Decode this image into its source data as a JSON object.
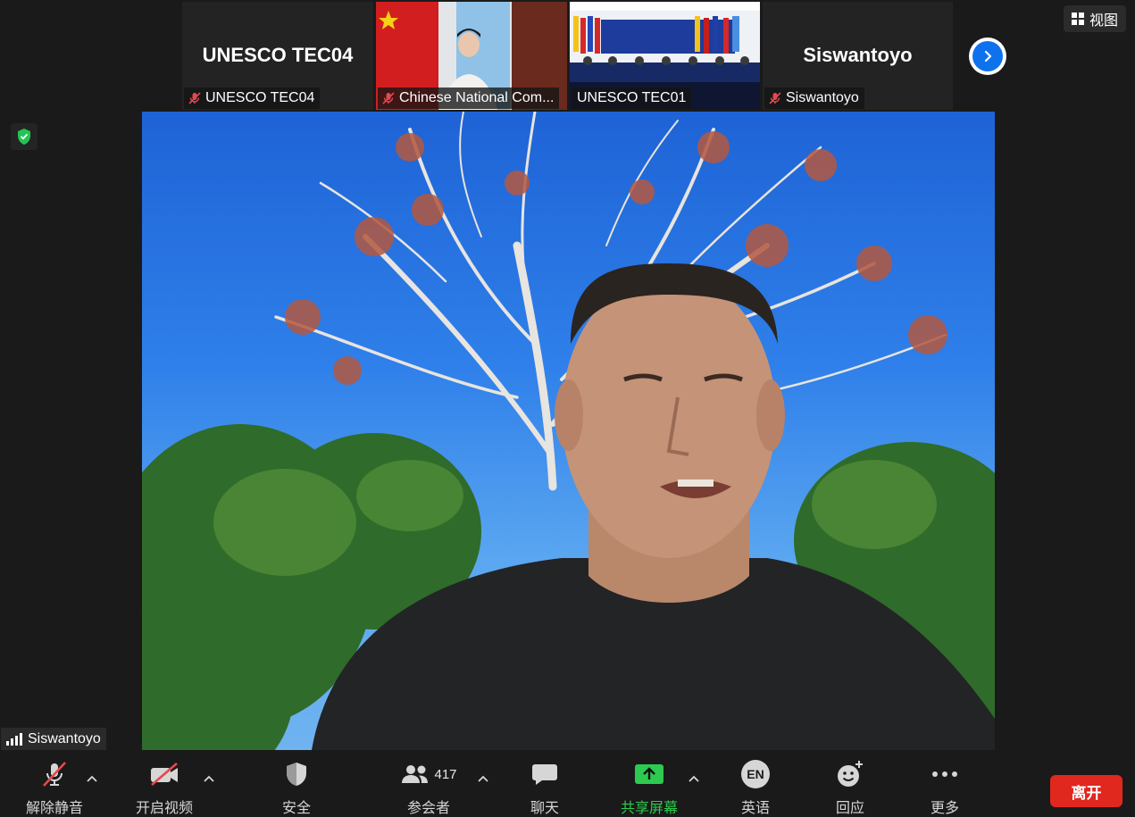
{
  "thumbnails": [
    {
      "id": "tec04",
      "center_name": "UNESCO TEC04",
      "label": "UNESCO TEC04",
      "muted": true
    },
    {
      "id": "chinese-commission",
      "center_name": "",
      "label": "Chinese National Com...",
      "muted": true
    },
    {
      "id": "tec01",
      "center_name": "",
      "label": "UNESCO TEC01",
      "muted": false
    },
    {
      "id": "siswantoyo-thumb",
      "center_name": "Siswantoyo",
      "label": "Siswantoyo",
      "muted": true
    }
  ],
  "view_button": {
    "label": "视图",
    "icon": "grid-icon"
  },
  "active_speaker": {
    "name": "Siswantoyo",
    "icon": "signal-bars-icon"
  },
  "toolbar": {
    "unmute": "解除静音",
    "start_video": "开启视频",
    "security": "安全",
    "participants": "参会者",
    "participant_count": "417",
    "chat": "聊天",
    "share_screen": "共享屏幕",
    "language": "英语",
    "language_badge": "EN",
    "reactions": "回应",
    "more": "更多"
  },
  "leave_button": "离开",
  "colors": {
    "accent_blue": "#0e72ed",
    "share_green": "#2dca4f",
    "leave_red": "#e0281f",
    "muted_red": "#e5484d"
  }
}
